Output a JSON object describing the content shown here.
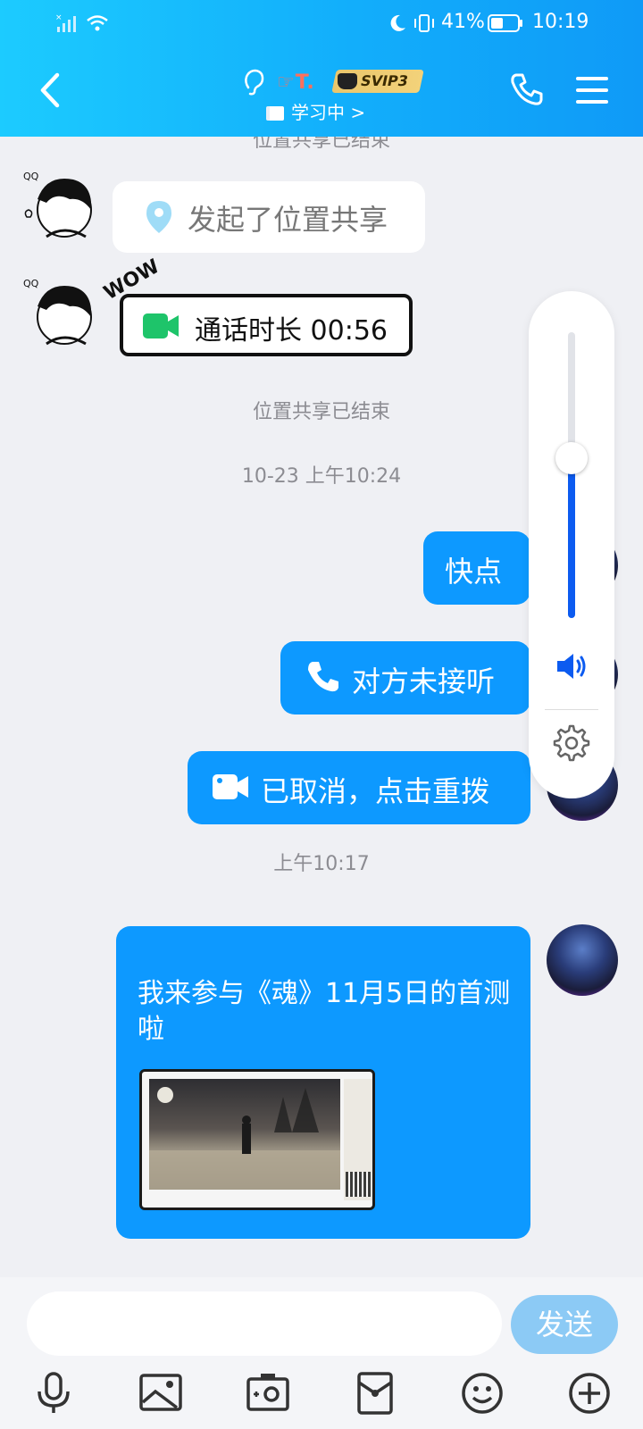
{
  "status_bar": {
    "battery_text": "41%",
    "time": "10:19"
  },
  "header": {
    "nickname_deco": "☞T.",
    "badge": "SVIP3",
    "subtitle": "学习中 >",
    "bg_colors": [
      "#1ccbff",
      "#0f9af7"
    ]
  },
  "chat": {
    "top_cut_system": "位置共享已结束",
    "messages": [
      {
        "side": "left",
        "type": "location",
        "text": "发起了位置共享"
      },
      {
        "side": "left",
        "type": "call",
        "text": "通话时长 00:56",
        "sticker": "WOW"
      },
      {
        "type": "system",
        "text": "位置共享已结束"
      },
      {
        "type": "time",
        "text": "10-23 上午10:24"
      },
      {
        "side": "right",
        "type": "text",
        "text": "快点"
      },
      {
        "side": "right",
        "type": "call",
        "text": "对方未接听"
      },
      {
        "side": "right",
        "type": "video",
        "text": "已取消，点击重拨"
      },
      {
        "type": "time",
        "text": "上午10:17"
      },
      {
        "side": "right",
        "type": "card",
        "text": "我来参与《魂》11月5日的首测啦"
      }
    ]
  },
  "volume_panel": {
    "level": 0.56,
    "accent": "#0c5bf0"
  },
  "input": {
    "placeholder": "",
    "send_label": "发送"
  },
  "toolbar_icons": [
    "mic-icon",
    "image-icon",
    "camera-icon",
    "red-packet-icon",
    "emoji-icon",
    "plus-icon"
  ]
}
